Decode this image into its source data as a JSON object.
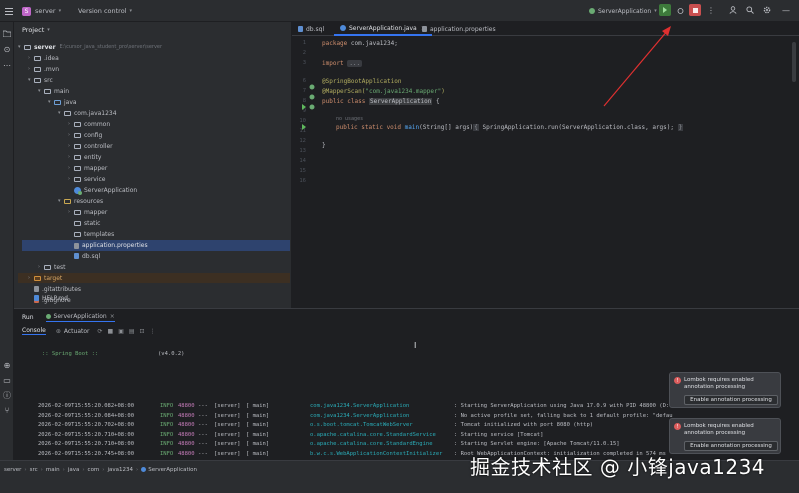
{
  "topbar": {
    "project_badge": "S",
    "project_name": "server",
    "vcs_label": "Version control",
    "run_config": "ServerApplication"
  },
  "project_panel": {
    "title": "Project",
    "tree": [
      {
        "label": "server",
        "path": "E:\\cursor_java_student_pro\\server\\server",
        "kind": "folder"
      },
      {
        "label": ".idea",
        "kind": "folder"
      },
      {
        "label": ".mvn",
        "kind": "folder"
      },
      {
        "label": "src",
        "kind": "folder"
      },
      {
        "label": "main",
        "kind": "folder"
      },
      {
        "label": "java",
        "kind": "src"
      },
      {
        "label": "com.java1234",
        "kind": "package"
      },
      {
        "label": "common",
        "kind": "package"
      },
      {
        "label": "config",
        "kind": "package"
      },
      {
        "label": "controller",
        "kind": "package"
      },
      {
        "label": "entity",
        "kind": "package"
      },
      {
        "label": "mapper",
        "kind": "package"
      },
      {
        "label": "service",
        "kind": "package"
      },
      {
        "label": "ServerApplication",
        "kind": "class"
      },
      {
        "label": "resources",
        "kind": "res"
      },
      {
        "label": "mapper",
        "kind": "folder"
      },
      {
        "label": "static",
        "kind": "folder"
      },
      {
        "label": "templates",
        "kind": "folder"
      },
      {
        "label": "application.properties",
        "kind": "props"
      },
      {
        "label": "db.sql",
        "kind": "sql"
      },
      {
        "label": "test",
        "kind": "folder"
      },
      {
        "label": "target",
        "kind": "target"
      },
      {
        "label": ".gitattributes",
        "kind": "file"
      },
      {
        "label": ".gitignore",
        "kind": "file"
      },
      {
        "label": "HELP.md",
        "kind": "md"
      }
    ]
  },
  "editor": {
    "tabs": [
      {
        "label": "db.sql"
      },
      {
        "label": "ServerApplication.java"
      },
      {
        "label": "application.properties"
      }
    ],
    "line_numbers": [
      "1",
      "2",
      "3",
      "",
      "6",
      "7",
      "8",
      "9",
      "10",
      "11",
      "12",
      "13",
      "14",
      "15",
      "16"
    ],
    "code": {
      "l1_kw": "package",
      "l1_rest": " com.java1234;",
      "l3_kw": "import",
      "l3_fold": "...",
      "l6": "@SpringBootApplication",
      "l7_an": "@MapperScan(",
      "l7_str": "\"com.java1234.mapper\"",
      "l7_end": ")",
      "l8_kw": "public class",
      "l8_name": "ServerApplication",
      "l8_end": " {",
      "l10_usages": "no usages",
      "l11_kw": "public static void",
      "l11_fn": "main",
      "l11_params": "(String[] args)",
      "l11_body": " SpringApplication.run(ServerApplication.class, args); ",
      "l13": "}"
    }
  },
  "run_panel": {
    "tab_run": "Run",
    "tab_config": "ServerApplication",
    "subtab_console": "Console",
    "subtab_actuator": "Actuator",
    "banner_left": ":: Spring Boot ::",
    "banner_right": "(v4.0.2)",
    "logs": [
      {
        "ts": "2026-02-09T15:55:20.082+08:00",
        "level": "INFO",
        "pid": "48800",
        "sep": "---",
        "app": "[server]",
        "thread": "[           main]",
        "logger": "com.java1234.ServerApplication",
        "msg": ": Starting ServerApplication using Java 17.0.9 with PID 48800 (D:\\"
      },
      {
        "ts": "2026-02-09T15:55:20.084+08:00",
        "level": "INFO",
        "pid": "48800",
        "sep": "---",
        "app": "[server]",
        "thread": "[           main]",
        "logger": "com.java1234.ServerApplication",
        "msg": ": No active profile set, falling back to 1 default profile: \"defau"
      },
      {
        "ts": "2026-02-09T15:55:20.702+08:00",
        "level": "INFO",
        "pid": "48800",
        "sep": "---",
        "app": "[server]",
        "thread": "[           main]",
        "logger": "o.s.boot.tomcat.TomcatWebServer",
        "msg": ": Tomcat initialized with port 8080 (http)"
      },
      {
        "ts": "2026-02-09T15:55:20.710+08:00",
        "level": "INFO",
        "pid": "48800",
        "sep": "---",
        "app": "[server]",
        "thread": "[           main]",
        "logger": "o.apache.catalina.core.StandardService",
        "msg": ": Starting service [Tomcat]"
      },
      {
        "ts": "2026-02-09T15:55:20.710+08:00",
        "level": "INFO",
        "pid": "48800",
        "sep": "---",
        "app": "[server]",
        "thread": "[           main]",
        "logger": "o.apache.catalina.core.StandardEngine",
        "msg": ": Starting Servlet engine: [Apache Tomcat/11.0.15]"
      },
      {
        "ts": "2026-02-09T15:55:20.745+08:00",
        "level": "INFO",
        "pid": "48800",
        "sep": "---",
        "app": "[server]",
        "thread": "[           main]",
        "logger": "b.w.c.s.WebApplicationContextInitializer",
        "msg": ": Root WebApplicationContext: initialization completed in 574 ms"
      },
      {
        "ts": "2026-02-09T15:55:21.147+08:00",
        "level": "INFO",
        "pid": "48800",
        "sep": "---",
        "app": "[server]",
        "thread": "[           main]",
        "logger": "o.s.boot.tomcat.TomcatWebServer",
        "msg": ": Tomcat started on port 8080 (http) with context path '/'"
      },
      {
        "ts": "2026-02-09T15:55:21.171+08:00",
        "level": "INFO",
        "pid": "48800",
        "sep": "---",
        "app": "[server]",
        "thread": "[           main]",
        "logger": "com.java1234.ServerApplication",
        "msg": ": Started ServerApplication in 1.456 seconds (process running for"
      }
    ]
  },
  "notifications": [
    {
      "text": "Lombok requires enabled annotation processing",
      "button": "Enable annotation processing"
    },
    {
      "text": "Lombok requires enabled annotation processing",
      "button": "Enable annotation processing"
    }
  ],
  "statusbar": {
    "breadcrumb": [
      "server",
      "src",
      "main",
      "java",
      "com",
      "java1234",
      "ServerApplication"
    ]
  },
  "watermark": "掘金技术社区 @ 小锋java1234",
  "colors": {
    "accent_blue": "#3574f0",
    "run_green": "#5fb85d",
    "stop_red": "#db5c5c",
    "arrow_red": "#e03030"
  },
  "icons": {
    "menu": "hamburger-icon",
    "run": "run-icon",
    "debug": "debug-icon",
    "stop": "stop-icon",
    "search": "search-icon",
    "settings": "gear-icon",
    "user": "user-icon"
  }
}
